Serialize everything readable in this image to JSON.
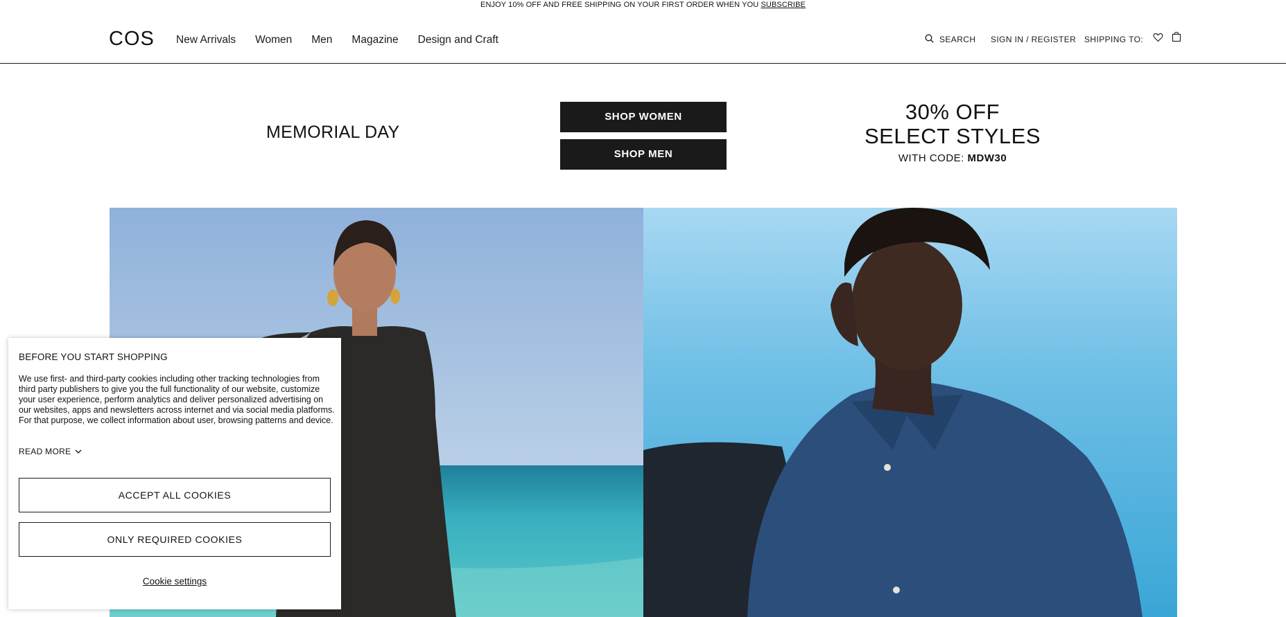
{
  "promo": {
    "text": "ENJOY 10% OFF AND FREE SHIPPING ON YOUR FIRST ORDER WHEN YOU ",
    "link": "SUBSCRIBE"
  },
  "header": {
    "logo": "COS",
    "nav": [
      "New Arrivals",
      "Women",
      "Men",
      "Magazine",
      "Design and Craft"
    ],
    "search_label": "SEARCH",
    "signin_label": "SIGN IN / REGISTER",
    "shipping_label": "SHIPPING TO:"
  },
  "hero": {
    "headline": "MEMORIAL DAY",
    "shop_women": "SHOP WOMEN",
    "shop_men": "SHOP MEN",
    "offer_line1": "30% OFF",
    "offer_line2": "SELECT STYLES",
    "code_prefix": "WITH CODE: ",
    "code": "MDW30"
  },
  "cookie": {
    "title": "BEFORE YOU START SHOPPING",
    "body": "We use first- and third-party cookies including other tracking technologies from third party publishers to give you the full functionality of our website, customize your user experience, perform analytics and deliver personalized advertising on our websites, apps and newsletters across internet and via social media platforms. For that purpose, we collect information about user, browsing patterns and device.",
    "read_more": "READ MORE",
    "accept_all": "ACCEPT ALL COOKIES",
    "only_required": "ONLY REQUIRED COOKIES",
    "settings": "Cookie settings"
  },
  "colors": {
    "button_dark": "#1a1a1a",
    "sky_left": "#9dbde0",
    "sky_right": "#a9d6f2",
    "sea": "#3aa8b8"
  },
  "icons": {
    "search": "search-icon",
    "wishlist": "heart-icon",
    "bag": "bag-icon",
    "read_more": "chevron-down-icon"
  }
}
